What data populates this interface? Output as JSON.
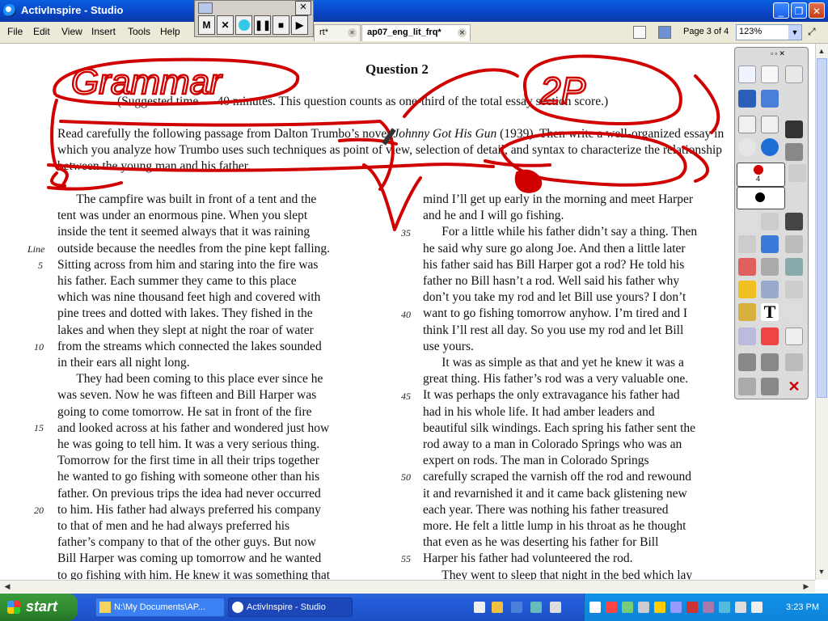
{
  "window": {
    "title": "ActivInspire - Studio"
  },
  "menu": [
    "File",
    "Edit",
    "View",
    "Insert",
    "Tools",
    "Help"
  ],
  "tabs": [
    {
      "label": "rt*",
      "active": false
    },
    {
      "label": "ap07_eng_lit_frq*",
      "active": true
    }
  ],
  "status": {
    "page": "Page 3 of 4",
    "zoom": "123%"
  },
  "recorder": {
    "buttons": [
      "M",
      "✕",
      "",
      "❚❚",
      "■",
      "▶"
    ]
  },
  "doc": {
    "title": "Question 2",
    "subtitle": "(Suggested time — 40 minutes. This question counts as one-third of the total essay section score.)",
    "prompt_a": "Read carefully the following passage from Dalton Trumbo’s novel ",
    "prompt_italic": "Johnny Got His Gun",
    "prompt_b": " (1939). Then write a well-organized essay in which you analyze how Trumbo uses such techniques as point of view, selection of detail, and syntax to characterize the relationship between the young man and his father.",
    "line_label": "Line",
    "left_lines": [
      "    The campfire was built in front of a tent and the",
      "tent was under an enormous pine. When you slept",
      "inside the tent it seemed always that it was raining",
      "outside because the needles from the pine kept falling.",
      "Sitting across from him and staring into the fire was",
      "his father. Each summer they came to this place",
      "which was nine thousand feet high and covered with",
      "pine trees and dotted with lakes. They fished in the",
      "lakes and when they slept at night the roar of water",
      "from the streams which connected the lakes sounded",
      "in their ears all night long.",
      "    They had been coming to this place ever since he",
      "was seven. Now he was fifteen and Bill Harper was",
      "going to come tomorrow. He sat in front of the fire",
      "and looked across at his father and wondered just how",
      "he was going to tell him. It was a very serious thing.",
      "Tomorrow for the first time in all their trips together",
      "he wanted to go fishing with someone other than his",
      "father. On previous trips the idea had never occurred",
      "to him. His father had always preferred his company",
      "to that of men and he had always preferred his",
      "father’s company to that of the other guys. But now",
      "Bill Harper was coming up tomorrow and he wanted",
      "to go fishing with him. He knew it was something that"
    ],
    "left_numbers": [
      "5",
      "10",
      "15",
      "20"
    ],
    "right_lines": [
      "mind I’ll get up early in the morning and meet Harper",
      "and he and I will go fishing.",
      "    For a little while his father didn’t say a thing. Then",
      "he said why sure go along Joe. And then a little later",
      "his father said has Bill Harper got a rod? He told his",
      "father no Bill hasn’t a rod. Well said his father why",
      "don’t you take my rod and let Bill use yours? I don’t",
      "want to go fishing tomorrow anyhow. I’m tired and I",
      "think I’ll rest all day. So you use my rod and let Bill",
      "use yours.",
      "    It was as simple as that and yet he knew it was a",
      "great thing. His father’s rod was a very valuable one.",
      "It was perhaps the only extravagance his father had",
      "had in his whole life. It had amber leaders and",
      "beautiful silk windings. Each spring his father sent the",
      "rod away to a man in Colorado Springs who was an",
      "expert on rods. The man in Colorado Springs",
      "carefully scraped the varnish off the rod and rewound",
      "it and revarnished it and it came back glistening new",
      "each year. There was nothing his father treasured",
      "more. He felt a little lump in his throat as he thought",
      "that even as he was deserting his father for Bill",
      "Harper his father had volunteered the rod.",
      "    They went to sleep that night in the bed which lay"
    ],
    "right_numbers": [
      "35",
      "40",
      "45",
      "50",
      "55"
    ],
    "annotations": {
      "grammar": "Grammar",
      "sp": "2P"
    }
  },
  "palette": {
    "pen_number": "4"
  },
  "taskbar": {
    "start": "start",
    "tasks": [
      "N:\\My Documents\\AP...",
      "ActivInspire - Studio"
    ],
    "clock": "3:23 PM"
  },
  "colors": {
    "ink": "#d00000",
    "accent": "#245edb",
    "start_green": "#2f8a2f"
  }
}
